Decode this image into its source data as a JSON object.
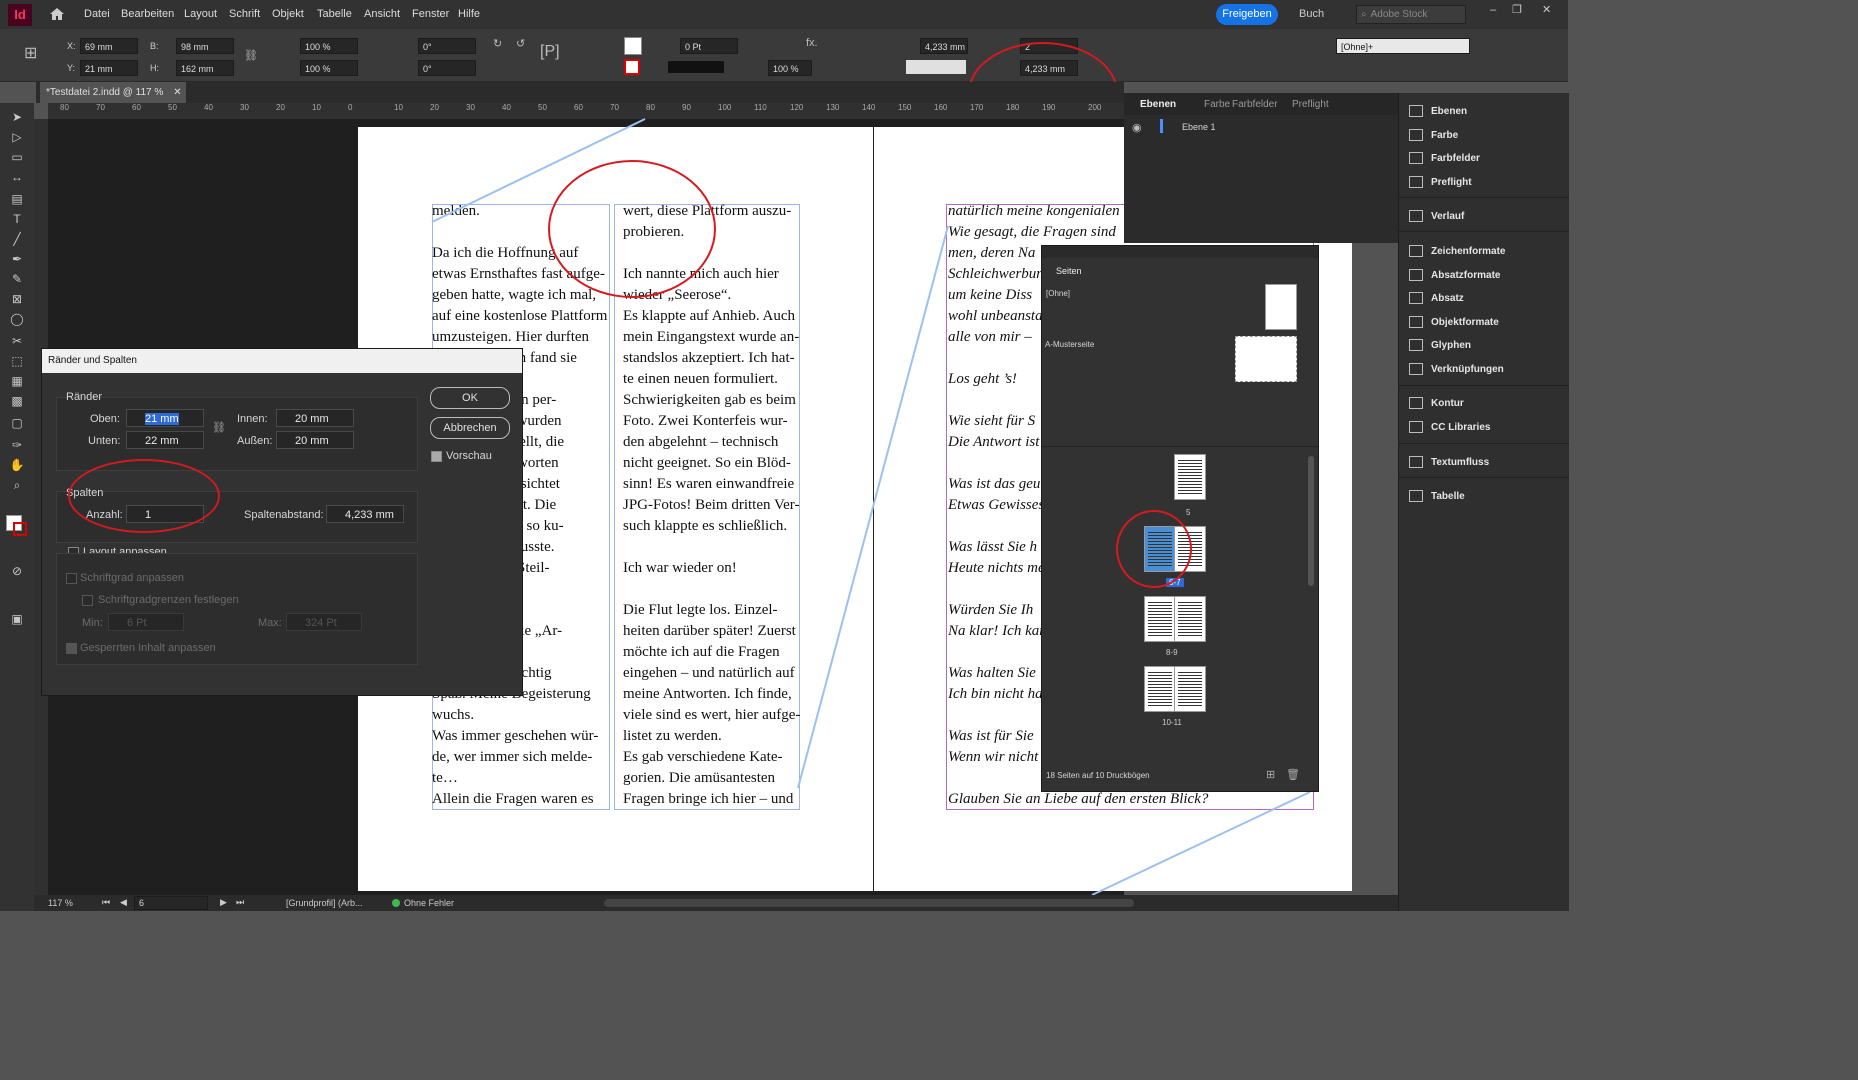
{
  "menubar": {
    "app_logo": "Id",
    "items": [
      "Datei",
      "Bearbeiten",
      "Layout",
      "Schrift",
      "Objekt",
      "Tabelle",
      "Ansicht",
      "Fenster",
      "Hilfe"
    ],
    "share": "Freigeben",
    "workspace": "Buch",
    "stock_placeholder": "Adobe Stock"
  },
  "control": {
    "x_label": "X:",
    "x": "69 mm",
    "y_label": "Y:",
    "y": "21 mm",
    "w_label": "B:",
    "w": "98 mm",
    "h_label": "H:",
    "h": "162 mm",
    "scale_x": "100 %",
    "scale_y": "100 %",
    "angle": "0°",
    "shear": "0°",
    "stroke": "0 Pt",
    "opacity": "100 %",
    "gutter": "4,233 mm",
    "columns": "2",
    "gutter2": "4,233 mm",
    "style": "[Ohne]+"
  },
  "document": {
    "tab": "*Testdatei 2.indd @ 117 %",
    "ruler_ticks": [
      "80",
      "70",
      "60",
      "50",
      "40",
      "30",
      "20",
      "10",
      "0",
      "10",
      "20",
      "30",
      "40",
      "50",
      "60",
      "70",
      "80",
      "90",
      "100",
      "110",
      "120",
      "130",
      "140",
      "150",
      "160",
      "170",
      "180",
      "190",
      "200"
    ]
  },
  "page_text": {
    "col1": "melden.\n\nDa ich die Hoffnung auf\netwas Ernsthaftes fast aufge-\ngeben hatte, wagte ich mal,\nauf eine kostenlose Plattform\numzusteigen. Hier durften\n                    Ich fand sie\n\n            üblichen per-\n            gaben wurden\n            en gestellt, die\n              beantworten\n              die gesichtet\n            animiert. Die\n            um Teil so ku-\n            chen musste.\n            ! Eine Steil-\n            ch!\n\n            ch an die „Ar-\n\n            achte richtig\nSpaß. Meine Begeisterung\nwuchs.\nWas immer geschehen wür-\nde, wer immer sich melde-\nte…\nAllein die Fragen waren es",
    "col2": "wert, diese Plattform auszu-\nprobieren.\n\nIch nannte mich auch hier\nwieder „Seerose“.\nEs klappte auf Anhieb. Auch\nmein Eingangstext wurde an-\nstandslos akzeptiert. Ich hat-\nte einen neuen formuliert.\nSchwierigkeiten gab es beim\nFoto. Zwei Konterfeis wur-\nden abgelehnt – technisch\nnicht geeignet. So ein Blöd-\nsinn! Es waren einwandfreie\nJPG-Fotos! Beim dritten Ver-\nsuch klappte es schließlich.\n\nIch war wieder on!\n\nDie Flut legte los. Einzel-\nheiten darüber später! Zuerst\nmöchte ich auf die Fragen\neingehen – und natürlich auf\nmeine Antworten. Ich finde,\nviele sind es wert, hier aufge-\nlistet zu werden.\nEs gab verschiedene Kate-\ngorien. Die amüsantesten\nFragen bringe ich hier – und",
    "col3": "natürlich meine kongenialen\nWie gesagt, die Fragen sind\nmen, deren Na\nSchleichwerbun\num keine Diss\nwohl unbeanstan\nalle von mir –\n\nLos geht ’s!\n\nWie sieht für S\nDie Antwort ist\n\nWas ist das geu\nEtwas Gewisses\n\nWas lässt Sie h\nHeute nichts me\n\nWürden Sie Ih\nNa klar! Ich kan\n\nWas halten Sie\nIch bin nicht ha\n\nWas ist für Sie\nWenn wir nicht\n\nGlauben Sie an Liebe auf den ersten Blick?"
  },
  "dialog": {
    "title": "Ränder und Spalten",
    "margins_group": "Ränder",
    "top_label": "Oben:",
    "top": "21 mm",
    "bottom_label": "Unten:",
    "bottom": "22 mm",
    "inside_label": "Innen:",
    "inside": "20 mm",
    "outside_label": "Außen:",
    "outside": "20 mm",
    "columns_group": "Spalten",
    "count_label": "Anzahl:",
    "count": "1",
    "gutter_label": "Spaltenabstand:",
    "gutter": "4,233 mm",
    "adjust_layout": "Layout anpassen",
    "adjust_font": "Schriftgrad anpassen",
    "font_limits": "Schriftgradgrenzen festlegen",
    "min_label": "Min:",
    "min": "6 Pt",
    "max_label": "Max:",
    "max": "324 Pt",
    "locked": "Gesperrten Inhalt anpassen",
    "ok": "OK",
    "cancel": "Abbrechen",
    "preview": "Vorschau"
  },
  "layers_panel": {
    "tabs": [
      "Ebenen",
      "Farbe",
      "Farbfelder",
      "Preflight"
    ],
    "layer": "Ebene 1"
  },
  "pages_panel": {
    "title": "Seiten",
    "none_master": "[Ohne]",
    "a_master": "A-Musterseite",
    "page_labels": [
      "5",
      "6-7",
      "8-9",
      "10-11"
    ],
    "footer": "18 Seiten auf 10 Druckbögen"
  },
  "dock": {
    "items": [
      "Ebenen",
      "Farbe",
      "Farbfelder",
      "Preflight",
      "Verlauf",
      "Zeichenformate",
      "Absatzformate",
      "Absatz",
      "Objektformate",
      "Glyphen",
      "Verknüpfungen",
      "Kontur",
      "CC Libraries",
      "Textumfluss",
      "Tabelle"
    ]
  },
  "status": {
    "zoom": "117 %",
    "page": "6",
    "profile": "[Grundprofil] (Arb...",
    "errors": "Ohne Fehler"
  }
}
